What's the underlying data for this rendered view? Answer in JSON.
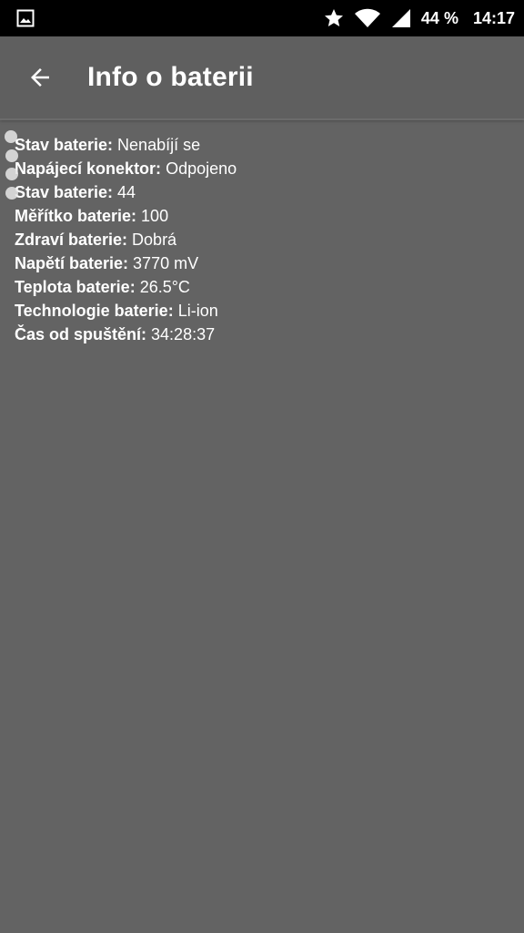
{
  "status_bar": {
    "battery": "44 %",
    "time": "14:17",
    "icons": [
      "gallery-icon",
      "star-icon",
      "wifi-icon",
      "signal-icon"
    ]
  },
  "app_bar": {
    "title": "Info o baterii",
    "back_icon": "arrow-left-icon"
  },
  "battery_info": [
    {
      "label": "Stav baterie:",
      "value": "Nenabíjí se"
    },
    {
      "label": "Napájecí konektor:",
      "value": "Odpojeno"
    },
    {
      "label": "Stav baterie:",
      "value": "44"
    },
    {
      "label": "Měřítko baterie:",
      "value": "100"
    },
    {
      "label": "Zdraví baterie:",
      "value": "Dobrá"
    },
    {
      "label": "Napětí baterie:",
      "value": "3770 mV"
    },
    {
      "label": "Teplota baterie:",
      "value": "26.5°C"
    },
    {
      "label": "Technologie baterie:",
      "value": "Li-ion"
    },
    {
      "label": "Čas od spuštění:",
      "value": "34:28:37"
    }
  ],
  "colors": {
    "background": "#636363",
    "status_bar": "#000000",
    "app_bar": "#5f5f5f",
    "text": "#ffffff"
  }
}
